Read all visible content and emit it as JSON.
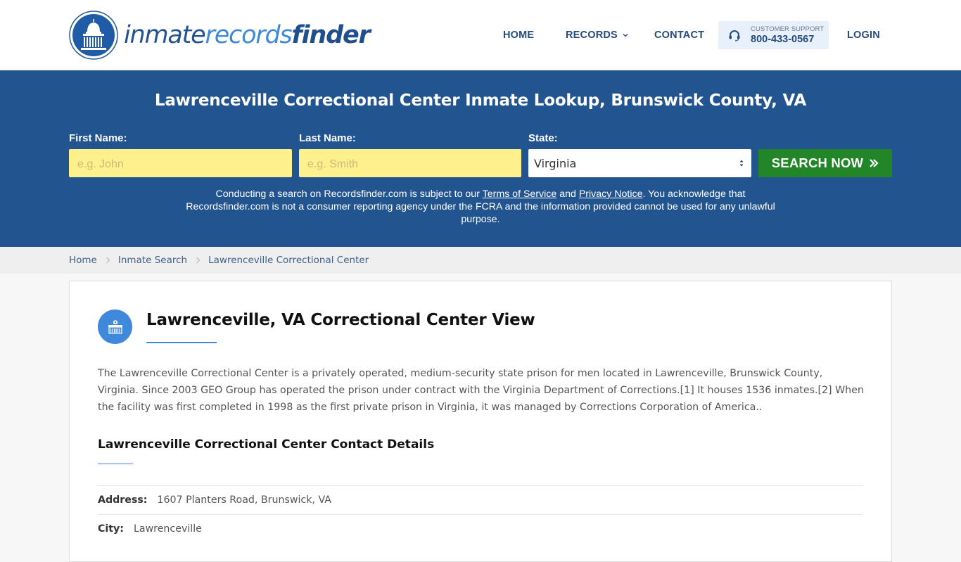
{
  "header": {
    "logo": {
      "part1": "inmate",
      "part2": "records",
      "part3": "finder",
      "icon": "capitol-dome-icon"
    },
    "nav": {
      "home": "HOME",
      "records": "RECORDS",
      "contact": "CONTACT",
      "login": "LOGIN"
    },
    "support": {
      "label": "CUSTOMER SUPPORT",
      "phone": "800-433-0567",
      "icon": "headset-icon"
    }
  },
  "hero": {
    "title": "Lawrenceville Correctional Center Inmate Lookup, Brunswick County, VA",
    "first_name": {
      "label": "First Name:",
      "placeholder": "e.g. John",
      "value": ""
    },
    "last_name": {
      "label": "Last Name:",
      "placeholder": "e.g. Smith",
      "value": ""
    },
    "state": {
      "label": "State:",
      "selected": "Virginia"
    },
    "search_button": "SEARCH NOW",
    "disclaimer": {
      "pre": "Conducting a search on Recordsfinder.com is subject to our ",
      "tos": "Terms of Service",
      "and": " and ",
      "privacy": "Privacy Notice",
      "post": ". You acknowledge that Recordsfinder.com is not a consumer reporting agency under the FCRA and the information provided cannot be used for any unlawful purpose."
    }
  },
  "breadcrumb": [
    {
      "label": "Home"
    },
    {
      "label": "Inmate Search"
    },
    {
      "label": "Lawrenceville Correctional Center"
    }
  ],
  "main": {
    "title": "Lawrenceville, VA Correctional Center View",
    "description": "The Lawrenceville Correctional Center is a privately operated, medium-security state prison for men located in Lawrenceville, Brunswick County, Virginia. Since 2003 GEO Group has operated the prison under contract with the Virginia Department of Corrections.[1] It houses 1536 inmates.[2] When the facility was first completed in 1998 as the first private prison in Virginia, it was managed by Corrections Corporation of America..",
    "contact_heading": "Lawrenceville Correctional Center Contact Details",
    "details": [
      {
        "key": "Address:",
        "value": "1607 Planters Road, Brunswick, VA"
      },
      {
        "key": "City:",
        "value": "Lawrenceville"
      }
    ]
  },
  "colors": {
    "brand_blue": "#22548f",
    "accent_blue": "#3f88db",
    "search_green": "#228528",
    "input_yellow": "#fff08e"
  }
}
